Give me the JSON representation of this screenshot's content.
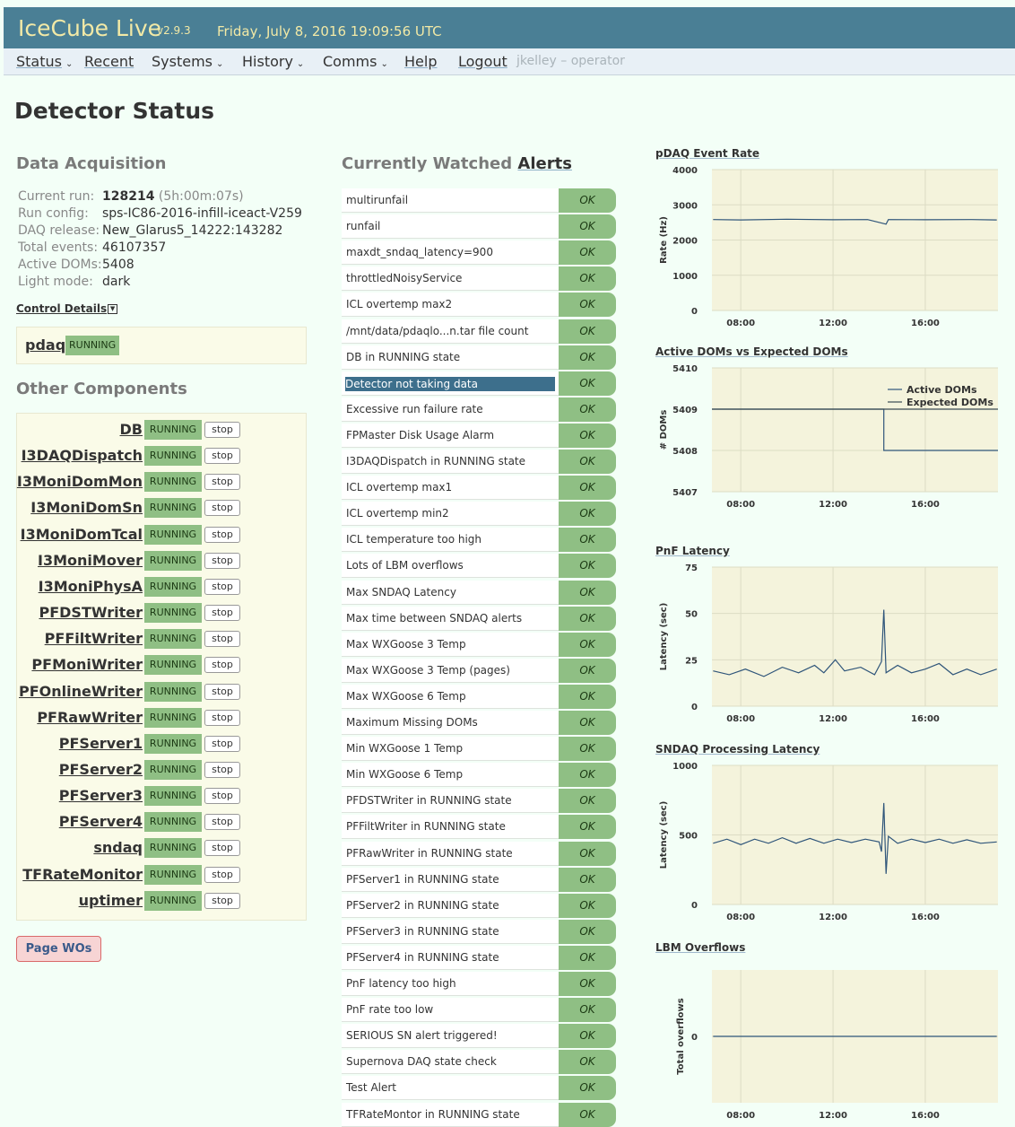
{
  "header": {
    "app_title": "IceCube Live",
    "version": "v2.9.3",
    "datetime": "Friday, July 8, 2016 19:09:56 UTC"
  },
  "nav": {
    "items": [
      {
        "label": "Status",
        "dropdown": true
      },
      {
        "label": "Recent",
        "dropdown": false
      },
      {
        "label": "Systems",
        "dropdown": true
      },
      {
        "label": "History",
        "dropdown": true
      },
      {
        "label": "Comms",
        "dropdown": true
      },
      {
        "label": "Help",
        "dropdown": false
      },
      {
        "label": "Logout",
        "dropdown": false
      }
    ],
    "user": "jkelley – operator"
  },
  "page_title": "Detector Status",
  "daq": {
    "title": "Data Acquisition",
    "rows": [
      {
        "key": "Current run:",
        "value": "128214",
        "extra": "(5h:00m:07s)"
      },
      {
        "key": "Run config:",
        "value": "sps-IC86-2016-infill-iceact-V259",
        "extra": ""
      },
      {
        "key": "DAQ release:",
        "value": "New_Glarus5_14222:143282",
        "extra": ""
      },
      {
        "key": "Total events:",
        "value": "46107357",
        "extra": ""
      },
      {
        "key": "Active DOMs:",
        "value": "5408",
        "extra": ""
      },
      {
        "key": "Light mode:",
        "value": "dark",
        "extra": ""
      }
    ],
    "control_details": "Control Details",
    "pdaq_name": "pdaq",
    "pdaq_status": "RUNNING"
  },
  "components": {
    "title": "Other Components",
    "status": "RUNNING",
    "stop_label": "stop",
    "items": [
      "DB",
      "I3DAQDispatch",
      "I3MoniDomMon",
      "I3MoniDomSn",
      "I3MoniDomTcal",
      "I3MoniMover",
      "I3MoniPhysA",
      "PFDSTWriter",
      "PFFiltWriter",
      "PFMoniWriter",
      "PFOnlineWriter",
      "PFRawWriter",
      "PFServer1",
      "PFServer2",
      "PFServer3",
      "PFServer4",
      "sndaq",
      "TFRateMonitor",
      "uptimer"
    ],
    "page_wos": "Page WOs"
  },
  "alerts": {
    "title_prefix": "Currently Watched",
    "title_link": "Alerts",
    "ok_label": "OK",
    "selected_index": 7,
    "items": [
      "multirunfail",
      "runfail",
      "maxdt_sndaq_latency=900",
      "throttledNoisyService",
      "ICL overtemp max2",
      "/mnt/data/pdaqlo...n.tar file count",
      "DB in RUNNING state",
      "Detector not taking data",
      "Excessive run failure rate",
      "FPMaster Disk Usage Alarm",
      "I3DAQDispatch in RUNNING state",
      "ICL overtemp max1",
      "ICL overtemp min2",
      "ICL temperature too high",
      "Lots of LBM overflows",
      "Max SNDAQ Latency",
      "Max time between SNDAQ alerts",
      "Max WXGoose 3 Temp",
      "Max WXGoose 3 Temp (pages)",
      "Max WXGoose 6 Temp",
      "Maximum Missing DOMs",
      "Min WXGoose 1 Temp",
      "Min WXGoose 6 Temp",
      "PFDSTWriter in RUNNING state",
      "PFFiltWriter in RUNNING state",
      "PFRawWriter in RUNNING state",
      "PFServer1 in RUNNING state",
      "PFServer2 in RUNNING state",
      "PFServer3 in RUNNING state",
      "PFServer4 in RUNNING state",
      "PnF latency too high",
      "PnF rate too low",
      "SERIOUS SN alert triggered!",
      "Supernova DAQ state check",
      "Test Alert",
      "TFRateMontor in RUNNING state"
    ]
  },
  "colors": {
    "header_bg": "#4a7f95",
    "header_text": "#f2e9a6",
    "running_green": "#8fbf84",
    "selected_row": "#3d6f8c",
    "plot_bg": "#f4f3dc",
    "line": "#2f557a"
  },
  "chart_data": [
    {
      "type": "line",
      "title": "pDAQ Event Rate",
      "ylabel": "Rate (Hz)",
      "ylim": [
        0,
        4000
      ],
      "yticks": [
        "4000",
        "3000",
        "2000",
        "1000",
        "0"
      ],
      "xticks": [
        "08:00",
        "12:00",
        "16:00"
      ],
      "x_range_hours": [
        6.75,
        19.15
      ],
      "grid": true,
      "series": [
        {
          "values": [
            [
              6.8,
              2580
            ],
            [
              8,
              2570
            ],
            [
              10,
              2590
            ],
            [
              12,
              2575
            ],
            [
              13.5,
              2580
            ],
            [
              14.3,
              2450
            ],
            [
              14.4,
              2580
            ],
            [
              16,
              2575
            ],
            [
              18,
              2580
            ],
            [
              19.1,
              2570
            ]
          ]
        }
      ]
    },
    {
      "type": "line",
      "title": "Active DOMs vs Expected DOMs",
      "ylabel": "# DOMs",
      "ylim": [
        5407,
        5410
      ],
      "yticks": [
        "5410",
        "5409",
        "5408",
        "5407"
      ],
      "xticks": [
        "08:00",
        "12:00",
        "16:00"
      ],
      "x_range_hours": [
        6.75,
        19.15
      ],
      "legend": "top-right",
      "grid": true,
      "series": [
        {
          "name": "Active DOMs",
          "values": [
            [
              6.75,
              5409
            ],
            [
              14.2,
              5409
            ],
            [
              14.2,
              5408
            ],
            [
              19.15,
              5408
            ]
          ]
        },
        {
          "name": "Expected DOMs",
          "values": [
            [
              6.75,
              5409
            ],
            [
              19.15,
              5409
            ]
          ]
        }
      ]
    },
    {
      "type": "line",
      "title": "PnF Latency",
      "ylabel": "Latency (sec)",
      "ylim": [
        0,
        75
      ],
      "yticks": [
        "75",
        "50",
        "25",
        "0"
      ],
      "xticks": [
        "08:00",
        "12:00",
        "16:00"
      ],
      "x_range_hours": [
        6.75,
        19.15
      ],
      "grid": true,
      "series": [
        {
          "values": [
            [
              6.8,
              19
            ],
            [
              7.5,
              17
            ],
            [
              8.2,
              20
            ],
            [
              9,
              16
            ],
            [
              9.8,
              21
            ],
            [
              10.5,
              18
            ],
            [
              11.2,
              22
            ],
            [
              11.6,
              18
            ],
            [
              12.1,
              25
            ],
            [
              12.5,
              19
            ],
            [
              13.2,
              21
            ],
            [
              13.8,
              17
            ],
            [
              14.1,
              24
            ],
            [
              14.2,
              52
            ],
            [
              14.3,
              18
            ],
            [
              14.8,
              22
            ],
            [
              15.4,
              18
            ],
            [
              16,
              20
            ],
            [
              16.6,
              23
            ],
            [
              17.2,
              17
            ],
            [
              17.8,
              20
            ],
            [
              18.4,
              17
            ],
            [
              19.1,
              20
            ]
          ]
        }
      ]
    },
    {
      "type": "line",
      "title": "SNDAQ Processing Latency",
      "ylabel": "Latency (sec)",
      "ylim": [
        0,
        1000
      ],
      "yticks": [
        "1000",
        "500",
        "0"
      ],
      "xticks": [
        "08:00",
        "12:00",
        "16:00"
      ],
      "x_range_hours": [
        6.75,
        19.15
      ],
      "grid": true,
      "series": [
        {
          "values": [
            [
              6.8,
              440
            ],
            [
              7.4,
              470
            ],
            [
              8,
              430
            ],
            [
              8.6,
              470
            ],
            [
              9.2,
              440
            ],
            [
              9.8,
              480
            ],
            [
              10.4,
              440
            ],
            [
              11,
              475
            ],
            [
              11.6,
              440
            ],
            [
              12.2,
              470
            ],
            [
              12.8,
              445
            ],
            [
              13.4,
              470
            ],
            [
              14,
              450
            ],
            [
              14.1,
              380
            ],
            [
              14.2,
              730
            ],
            [
              14.3,
              220
            ],
            [
              14.4,
              490
            ],
            [
              14.8,
              440
            ],
            [
              15.4,
              470
            ],
            [
              16,
              445
            ],
            [
              16.6,
              470
            ],
            [
              17.2,
              440
            ],
            [
              17.8,
              465
            ],
            [
              18.4,
              440
            ],
            [
              19.1,
              450
            ]
          ]
        }
      ]
    },
    {
      "type": "line",
      "title": "LBM Overflows",
      "ylabel": "Total overflows",
      "yticks": [
        "0"
      ],
      "xticks": [
        "08:00",
        "12:00",
        "16:00"
      ],
      "x_range_hours": [
        6.75,
        19.15
      ],
      "grid": true,
      "series": [
        {
          "values": [
            [
              6.8,
              0
            ],
            [
              19.1,
              0
            ]
          ]
        }
      ]
    }
  ]
}
